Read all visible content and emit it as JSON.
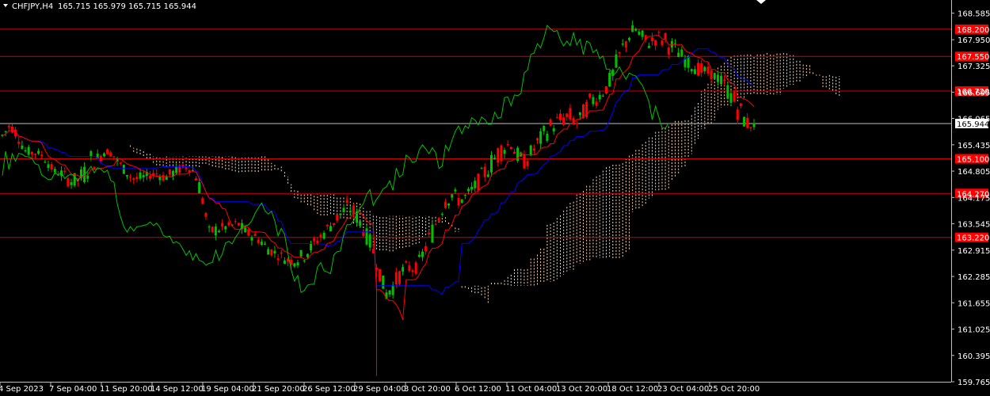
{
  "window": {
    "symbol": "CHFJPY,H4",
    "ohlc": "165.715 165.979 165.715 165.944"
  },
  "colors": {
    "background": "#000000",
    "bull": "#00c000",
    "bear": "#ff0000",
    "level_line": "#d00000",
    "level_badge": "#ff0000",
    "kijun": "#0000ff",
    "tenkan": "#ff0000",
    "chikou": "#00c000",
    "cloud": "#ffd8b0",
    "current_price_line": "#c0c0c0"
  },
  "chart_data": {
    "type": "candlestick",
    "title": "CHFJPY,H4",
    "y_axis": {
      "ylim": [
        159.765,
        168.9
      ],
      "ticks": [
        "168.585",
        "167.950",
        "167.325",
        "166.695",
        "166.065",
        "165.435",
        "164.805",
        "164.175",
        "163.545",
        "162.915",
        "162.285",
        "161.655",
        "161.025",
        "160.395",
        "159.765"
      ]
    },
    "x_axis": {
      "labels": [
        "4 Sep 2023",
        "7 Sep 04:00",
        "11 Sep 20:00",
        "14 Sep 12:00",
        "19 Sep 04:00",
        "21 Sep 20:00",
        "26 Sep 12:00",
        "29 Sep 04:00",
        "3 Oct 20:00",
        "6 Oct 12:00",
        "11 Oct 04:00",
        "13 Oct 20:00",
        "18 Oct 12:00",
        "23 Oct 04:00",
        "25 Oct 20:00"
      ]
    },
    "horizontal_levels": [
      "168.200",
      "167.550",
      "166.720",
      "165.100",
      "164.270",
      "163.220"
    ],
    "current_price": "165.944",
    "indicators": [
      "Ichimoku Kinko Hyo (tenkan, kijun, chikou, cloud)"
    ],
    "price_path": [
      [
        165.4,
        165.9
      ],
      [
        165.8,
        166.0
      ],
      [
        165.5,
        165.9
      ],
      [
        165.2,
        165.4
      ],
      [
        165.1,
        165.4
      ],
      [
        165.2,
        165.3
      ],
      [
        164.9,
        165.2
      ],
      [
        164.7,
        164.9
      ],
      [
        164.6,
        164.9
      ],
      [
        164.4,
        164.8
      ],
      [
        164.3,
        164.8
      ],
      [
        164.4,
        165.0
      ],
      [
        164.7,
        165.4
      ],
      [
        164.9,
        165.3
      ],
      [
        165.2,
        165.4
      ],
      [
        165.1,
        165.3
      ],
      [
        164.8,
        165.1
      ],
      [
        164.6,
        164.9
      ],
      [
        164.4,
        164.8
      ],
      [
        164.5,
        164.8
      ],
      [
        164.6,
        164.8
      ],
      [
        164.6,
        164.9
      ],
      [
        164.5,
        164.8
      ],
      [
        164.6,
        164.9
      ],
      [
        164.7,
        165.0
      ],
      [
        164.8,
        165.0
      ],
      [
        164.7,
        164.9
      ],
      [
        164.0,
        164.6
      ],
      [
        163.2,
        163.5
      ],
      [
        163.2,
        163.6
      ],
      [
        163.3,
        163.6
      ],
      [
        163.4,
        163.6
      ],
      [
        163.4,
        163.7
      ],
      [
        163.2,
        163.5
      ],
      [
        163.1,
        163.4
      ],
      [
        163.0,
        163.3
      ],
      [
        162.8,
        163.1
      ],
      [
        162.7,
        163.0
      ],
      [
        162.6,
        162.9
      ],
      [
        162.5,
        162.8
      ],
      [
        162.5,
        162.9
      ],
      [
        162.6,
        163.0
      ],
      [
        162.8,
        163.2
      ],
      [
        163.0,
        163.4
      ],
      [
        163.2,
        163.6
      ],
      [
        163.4,
        163.8
      ],
      [
        163.6,
        164.0
      ],
      [
        163.7,
        164.2
      ],
      [
        163.5,
        164.0
      ],
      [
        163.2,
        163.6
      ],
      [
        162.8,
        163.3
      ],
      [
        162.3,
        162.8
      ],
      [
        161.6,
        162.1
      ],
      [
        161.8,
        162.3
      ],
      [
        162.1,
        162.6
      ],
      [
        162.3,
        162.7
      ],
      [
        162.3,
        162.6
      ],
      [
        162.6,
        163.0
      ],
      [
        162.9,
        163.5
      ],
      [
        163.3,
        164.0
      ],
      [
        163.8,
        164.5
      ],
      [
        164.0,
        164.5
      ],
      [
        163.9,
        164.3
      ],
      [
        164.0,
        164.4
      ],
      [
        164.2,
        164.6
      ],
      [
        164.4,
        164.9
      ],
      [
        164.6,
        165.2
      ],
      [
        164.8,
        165.5
      ],
      [
        165.1,
        165.7
      ],
      [
        165.3,
        165.6
      ],
      [
        164.9,
        165.4
      ],
      [
        164.8,
        165.2
      ],
      [
        165.0,
        165.6
      ],
      [
        165.3,
        165.8
      ],
      [
        165.5,
        166.1
      ],
      [
        165.7,
        166.2
      ],
      [
        165.8,
        166.3
      ],
      [
        165.8,
        166.4
      ],
      [
        165.8,
        166.1
      ],
      [
        166.0,
        166.5
      ],
      [
        166.2,
        166.8
      ],
      [
        166.4,
        166.8
      ],
      [
        166.6,
        167.0
      ],
      [
        166.8,
        167.5
      ],
      [
        167.3,
        168.0
      ],
      [
        167.8,
        168.3
      ],
      [
        168.0,
        168.4
      ],
      [
        167.6,
        168.2
      ],
      [
        167.7,
        168.1
      ],
      [
        167.8,
        168.2
      ],
      [
        167.6,
        168.2
      ],
      [
        167.5,
        168.0
      ],
      [
        167.4,
        167.8
      ],
      [
        167.2,
        167.6
      ],
      [
        167.1,
        167.5
      ],
      [
        167.0,
        167.4
      ],
      [
        167.0,
        167.3
      ],
      [
        166.9,
        167.2
      ],
      [
        166.6,
        167.1
      ],
      [
        166.3,
        166.9
      ],
      [
        165.9,
        166.6
      ],
      [
        165.7,
        166.2
      ],
      [
        165.8,
        166.0
      ]
    ]
  }
}
